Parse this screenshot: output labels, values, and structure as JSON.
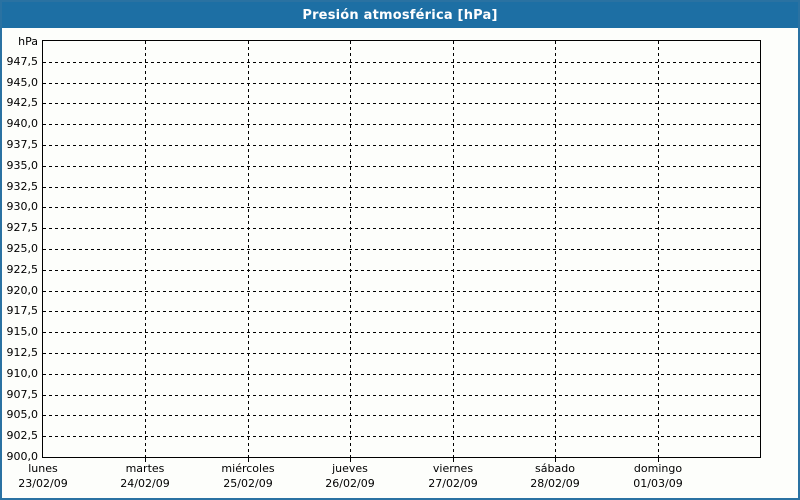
{
  "window": {
    "title": "Presión atmosférica [hPa]"
  },
  "colors": {
    "title_bg": "#1d6fa4",
    "title_text": "#ffffff",
    "frame_border": "#2a72a2",
    "background": "#fdfefb",
    "grid": "#000000",
    "label_text": "#000000"
  },
  "chart_data": {
    "type": "line",
    "title": "Presión atmosférica [hPa]",
    "y_axis": {
      "unit": "hPa",
      "min": 900,
      "max": 950,
      "tick_step": 2.5,
      "tick_labels": [
        "947,5",
        "945,0",
        "942,5",
        "940,0",
        "937,5",
        "935,0",
        "932,5",
        "930,0",
        "927,5",
        "925,0",
        "922,5",
        "920,0",
        "917,5",
        "915,0",
        "912,5",
        "910,0",
        "907,5",
        "905,0",
        "902,5",
        "900,0"
      ]
    },
    "x_axis": {
      "days": [
        {
          "name": "lunes",
          "date": "23/02/09"
        },
        {
          "name": "martes",
          "date": "24/02/09"
        },
        {
          "name": "miércoles",
          "date": "25/02/09"
        },
        {
          "name": "jueves",
          "date": "26/02/09"
        },
        {
          "name": "viernes",
          "date": "27/02/09"
        },
        {
          "name": "sábado",
          "date": "28/02/09"
        },
        {
          "name": "domingo",
          "date": "01/03/09"
        }
      ]
    },
    "series": [],
    "grid": {
      "style": "dashed",
      "horizontal": true,
      "vertical": true
    },
    "legend": null
  }
}
